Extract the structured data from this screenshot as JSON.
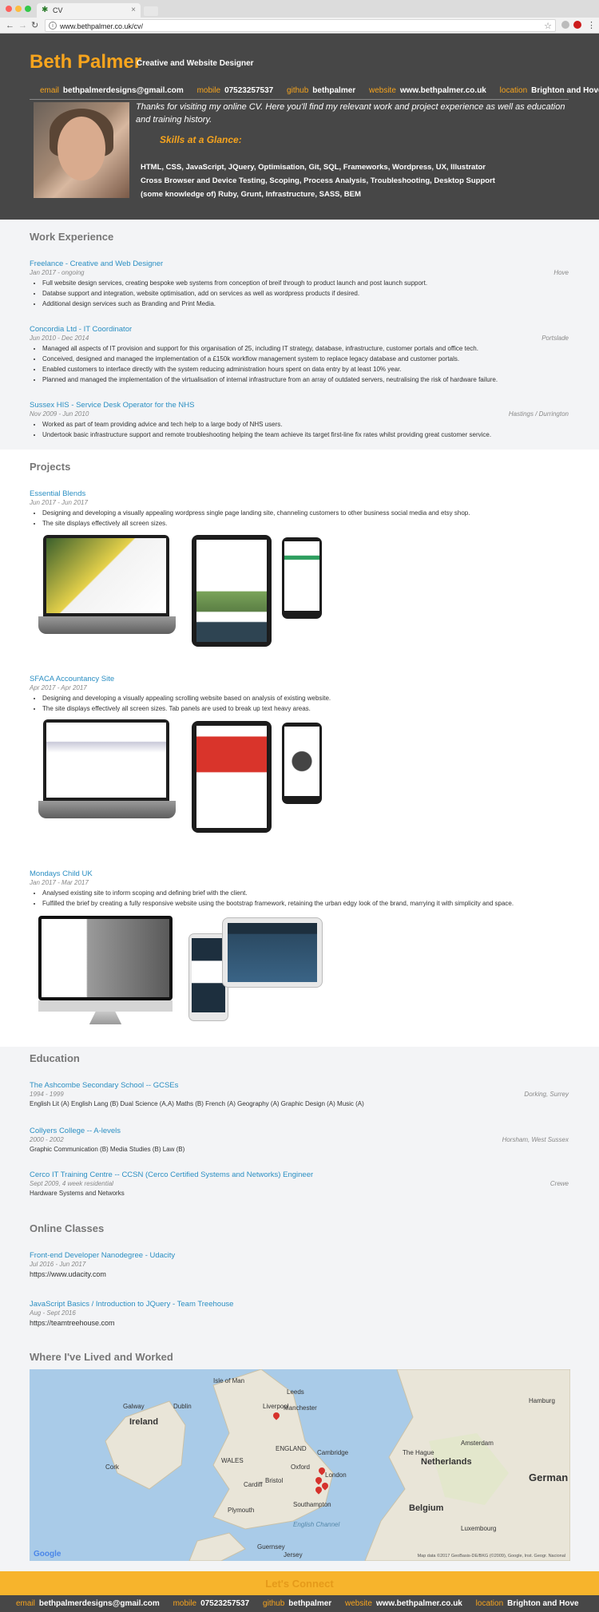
{
  "browser": {
    "tab_title": "CV",
    "url": "www.bethpalmer.co.uk/cv/"
  },
  "header": {
    "name": "Beth Palmer",
    "tagline": "Creative and Website Designer",
    "contacts": [
      {
        "label": "email",
        "value": "bethpalmerdesigns@gmail.com"
      },
      {
        "label": "mobile",
        "value": "07523257537"
      },
      {
        "label": "github",
        "value": "bethpalmer"
      },
      {
        "label": "website",
        "value": "www.bethpalmer.co.uk"
      },
      {
        "label": "location",
        "value": "Brighton and Hove"
      }
    ],
    "intro": "Thanks for visiting my online CV. Here you'll find my relevant work and project experience as well as education and training history.",
    "skills_title": "Skills at a Glance:",
    "skills": [
      "HTML, CSS, JavaScript, JQuery, Optimisation, Git, SQL, Frameworks, Wordpress, UX, Illustrator",
      "Cross Browser and Device Testing, Scoping, Process Analysis, Troubleshooting, Desktop Support",
      "(some knowledge of) Ruby, Grunt, Infrastructure, SASS, BEM"
    ]
  },
  "work": {
    "title": "Work Experience",
    "items": [
      {
        "title": "Freelance - Creative and Web Designer",
        "date": "Jan 2017 - ongoing",
        "location": "Hove",
        "bullets": [
          "Full website design services, creating bespoke web systems from conception of breif through to product launch and post launch support.",
          "Databse support and integration, website optimisation, add on services as well as wordpress products if desired.",
          "Additional design services such as Branding and Print Media."
        ]
      },
      {
        "title": "Concordia Ltd - IT Coordinator",
        "date": "Jun 2010 - Dec 2014",
        "location": "Portslade",
        "bullets": [
          "Managed all aspects of IT provision and support for this organisation of 25, including IT strategy, database, infrastructure, customer portals and office tech.",
          "Conceived, designed and managed the implementation of a £150k workflow management system to replace legacy database and customer portals.",
          "Enabled customers to interface directly with the system reducing administration hours spent on data entry by at least 10% year.",
          "Planned and managed the implementation of the virtualisation of internal infrastructure from an array of outdated servers, neutralising the risk of hardware failure."
        ]
      },
      {
        "title": "Sussex HIS - Service Desk Operator for the NHS",
        "date": "Nov 2009 - Jun 2010",
        "location": "Hastings / Durrington",
        "bullets": [
          "Worked as part of team providing advice and tech help to a large body of NHS users.",
          "Undertook basic infrastructure support and remote troubleshooting helping the team achieve its target first-line fix rates whilst providing great customer service."
        ]
      }
    ]
  },
  "projects": {
    "title": "Projects",
    "items": [
      {
        "title": "Essential Blends",
        "date": "Jun 2017 - Jun 2017",
        "bullets": [
          "Designing and developing a visually appealing wordpress single page landing site, channeling customers to other business social media and etsy shop.",
          "The site displays effectively all screen sizes."
        ]
      },
      {
        "title": "SFACA Accountancy Site",
        "date": "Apr 2017 - Apr 2017",
        "bullets": [
          "Designing and developing a visually appealing scrolling website based on analysis of existing website.",
          "The site displays effectively all screen sizes. Tab panels are used to break up text heavy areas."
        ]
      },
      {
        "title": "Mondays Child UK",
        "date": "Jan 2017 - Mar 2017",
        "bullets": [
          "Analysed existing site to inform scoping and defining brief with the client.",
          "Fulfilled the brief by creating a fully responsive website using the bootstrap framework, retaining the urban edgy look of the brand, marrying it with simplicity and space."
        ]
      }
    ]
  },
  "education": {
    "title": "Education",
    "items": [
      {
        "title": "The Ashcombe Secondary School -- GCSEs",
        "date": "1994 - 1999",
        "location": "Dorking, Surrey",
        "detail": "English Lit (A)  English Lang (B)  Dual Science (A,A)  Maths (B)  French (A)  Geography (A)  Graphic Design (A)  Music (A)"
      },
      {
        "title": "Collyers College -- A-levels",
        "date": "2000 - 2002",
        "location": "Horsham, West Sussex",
        "detail": "Graphic Communication (B)  Media Studies (B)  Law (B)"
      },
      {
        "title": "Cerco IT Training Centre -- CCSN (Cerco Certified Systems and Networks) Engineer",
        "date": "Sept 2009, 4 week residential",
        "location": "Crewe",
        "detail": "Hardware Systems and Networks"
      }
    ]
  },
  "online": {
    "title": "Online Classes",
    "items": [
      {
        "title": "Front-end Developer Nanodegree - Udacity",
        "date": "Jul 2016 - Jun 2017",
        "detail": "https://www.udacity.com"
      },
      {
        "title": "JavaScript Basics / Introduction to JQuery - Team Treehouse",
        "date": "Aug - Sept 2016",
        "detail": "https://teamtreehouse.com"
      }
    ]
  },
  "map": {
    "title": "Where I've Lived and Worked",
    "labels": [
      "Isle of Man",
      "Leeds",
      "Ireland",
      "Dublin",
      "Liverpool",
      "Manchester",
      "WALES",
      "ENGLAND",
      "Cambridge",
      "Oxford",
      "London",
      "Bristol",
      "Cardiff",
      "Plymouth",
      "Southampton",
      "Netherlands",
      "The Hague",
      "Amsterdam",
      "Belgium",
      "German",
      "Hamburg",
      "Luxembourg",
      "Guernsey",
      "Jersey",
      "English Channel",
      "Galway",
      "Cork"
    ],
    "credit": "Map data ©2017 GeoBasis-DE/BKG (©2009), Google, Inst. Geogr. Nacional",
    "logo": "Google"
  },
  "footer": {
    "connect": "Let's Connect"
  },
  "colors": {
    "accent": "#f7a41d",
    "header_bg": "#474747",
    "link": "#2b8fc3"
  }
}
